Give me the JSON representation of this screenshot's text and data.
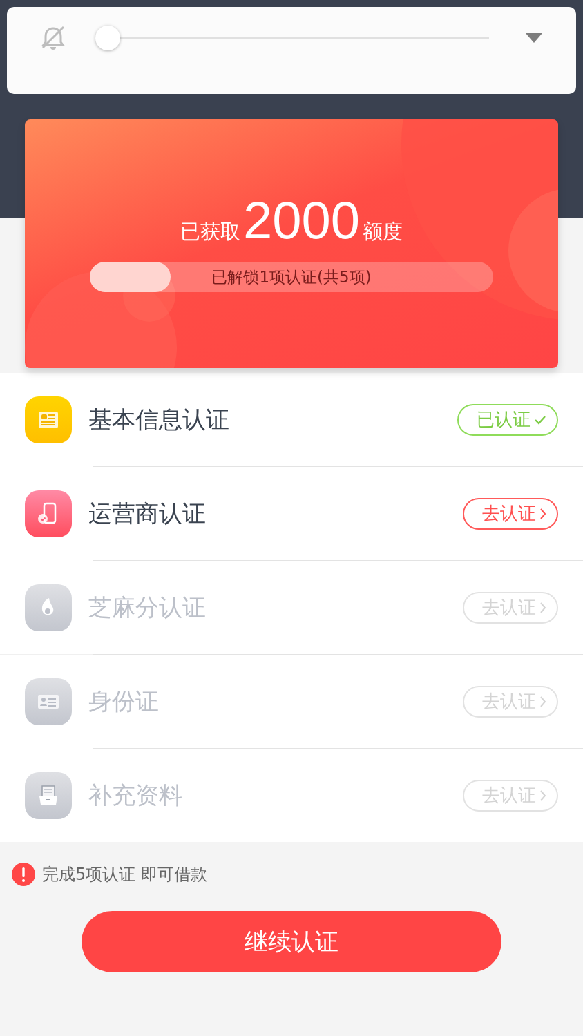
{
  "volume_popup": {
    "muted": true,
    "level": 0
  },
  "quota_card": {
    "prefix": "已获取",
    "amount": "2000",
    "suffix": "额度",
    "progress": {
      "level": 0.2,
      "label": "已解锁1项认证(共5项)"
    }
  },
  "items": [
    {
      "kind": "document",
      "name": "基本信息认证",
      "verified": true,
      "disabled": false,
      "action": "已认证"
    },
    {
      "kind": "phone",
      "name": "运营商认证",
      "verified": false,
      "disabled": false,
      "action": "去认证"
    },
    {
      "kind": "drop",
      "name": "芝麻分认证",
      "verified": false,
      "disabled": true,
      "action": "去认证"
    },
    {
      "kind": "idcard",
      "name": "身份证",
      "verified": false,
      "disabled": true,
      "action": "去认证"
    },
    {
      "kind": "drawer",
      "name": "补充资料",
      "verified": false,
      "disabled": true,
      "action": "去认证"
    }
  ],
  "notice": "完成5项认证 即可借款",
  "continue_button": "继续认证"
}
